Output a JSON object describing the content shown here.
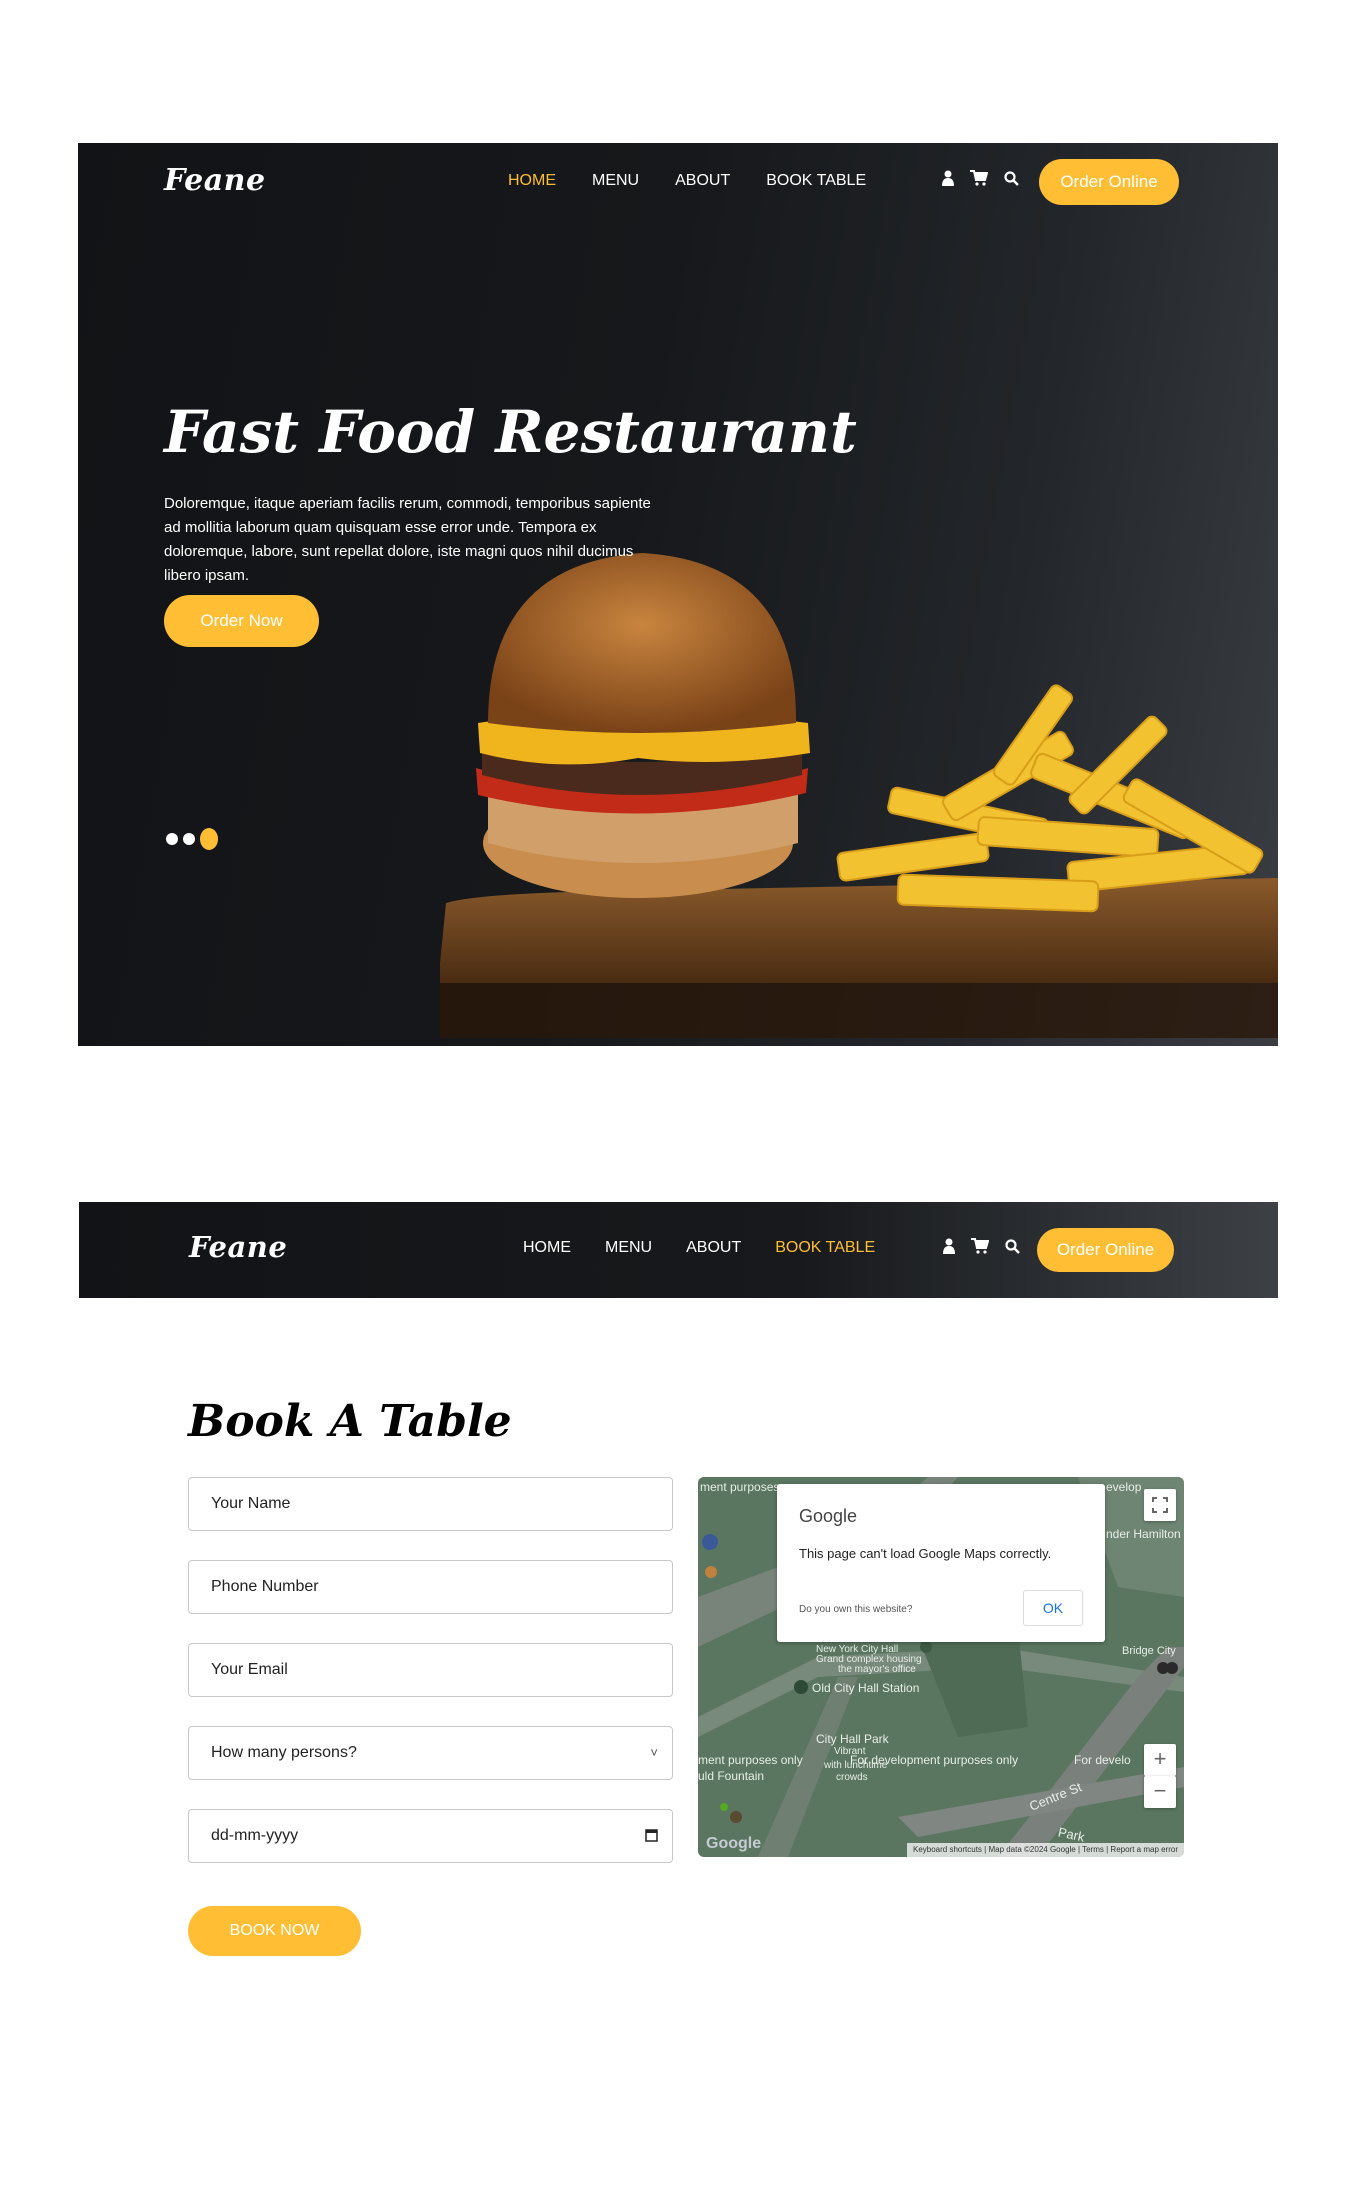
{
  "hero": {
    "logo": "Feane",
    "nav": [
      "HOME",
      "MENU",
      "ABOUT",
      "BOOK TABLE"
    ],
    "active_nav": "HOME",
    "order_online": "Order Online",
    "title": "Fast Food Restaurant",
    "text": "Doloremque, itaque aperiam facilis rerum, commodi, temporibus sapiente ad mollitia laborum quam quisquam esse error unde. Tempora ex doloremque, labore, sunt repellat dolore, iste magni quos nihil ducimus libero ipsam.",
    "order_now": "Order Now",
    "slides": 3,
    "active_slide": 3
  },
  "booking_nav": {
    "logo": "Feane",
    "nav": [
      "HOME",
      "MENU",
      "ABOUT",
      "BOOK TABLE"
    ],
    "active_nav": "BOOK TABLE",
    "order_online": "Order Online"
  },
  "book": {
    "title": "Book A Table",
    "name_placeholder": "Your Name",
    "phone_placeholder": "Phone Number",
    "email_placeholder": "Your Email",
    "persons_selected": "How many persons?",
    "date_placeholder": "dd-mm-yyyy",
    "submit": "BOOK NOW"
  },
  "map": {
    "dialog_brand": "Google",
    "dialog_message": "This page can't load Google Maps correctly.",
    "dialog_question": "Do you own this website?",
    "dialog_ok": "OK",
    "labels": {
      "top_left": "ment purposes",
      "top_right": "evelop",
      "hamilton": "nder Hamilton",
      "bridge": "Bridge City",
      "city_hall": "Old City Hall Station",
      "nyc_hall_1": "New York City Hall",
      "nyc_hall_2": "Grand complex housing",
      "nyc_hall_3": "the mayor's office",
      "park": "City Hall Park",
      "park_2": "Vibrant",
      "park_3": "with lunchtime",
      "park_4": "crowds",
      "dev_left": "ment purposes only",
      "fountain": "uld Fountain",
      "dev_mid": "For development purposes only",
      "dev_right": "For develo",
      "centre": "Centre St",
      "park_row": "Park"
    },
    "footer": "Keyboard shortcuts | Map data ©2024 Google | Terms | Report a map error",
    "google": "Google",
    "zoom_in": "+",
    "zoom_out": "−"
  },
  "icons": [
    "user-icon",
    "cart-icon",
    "search-icon",
    "fullscreen-icon",
    "calendar-icon",
    "chevron-down-icon"
  ],
  "colors": {
    "accent": "#ffbe33",
    "dark": "#121316"
  }
}
